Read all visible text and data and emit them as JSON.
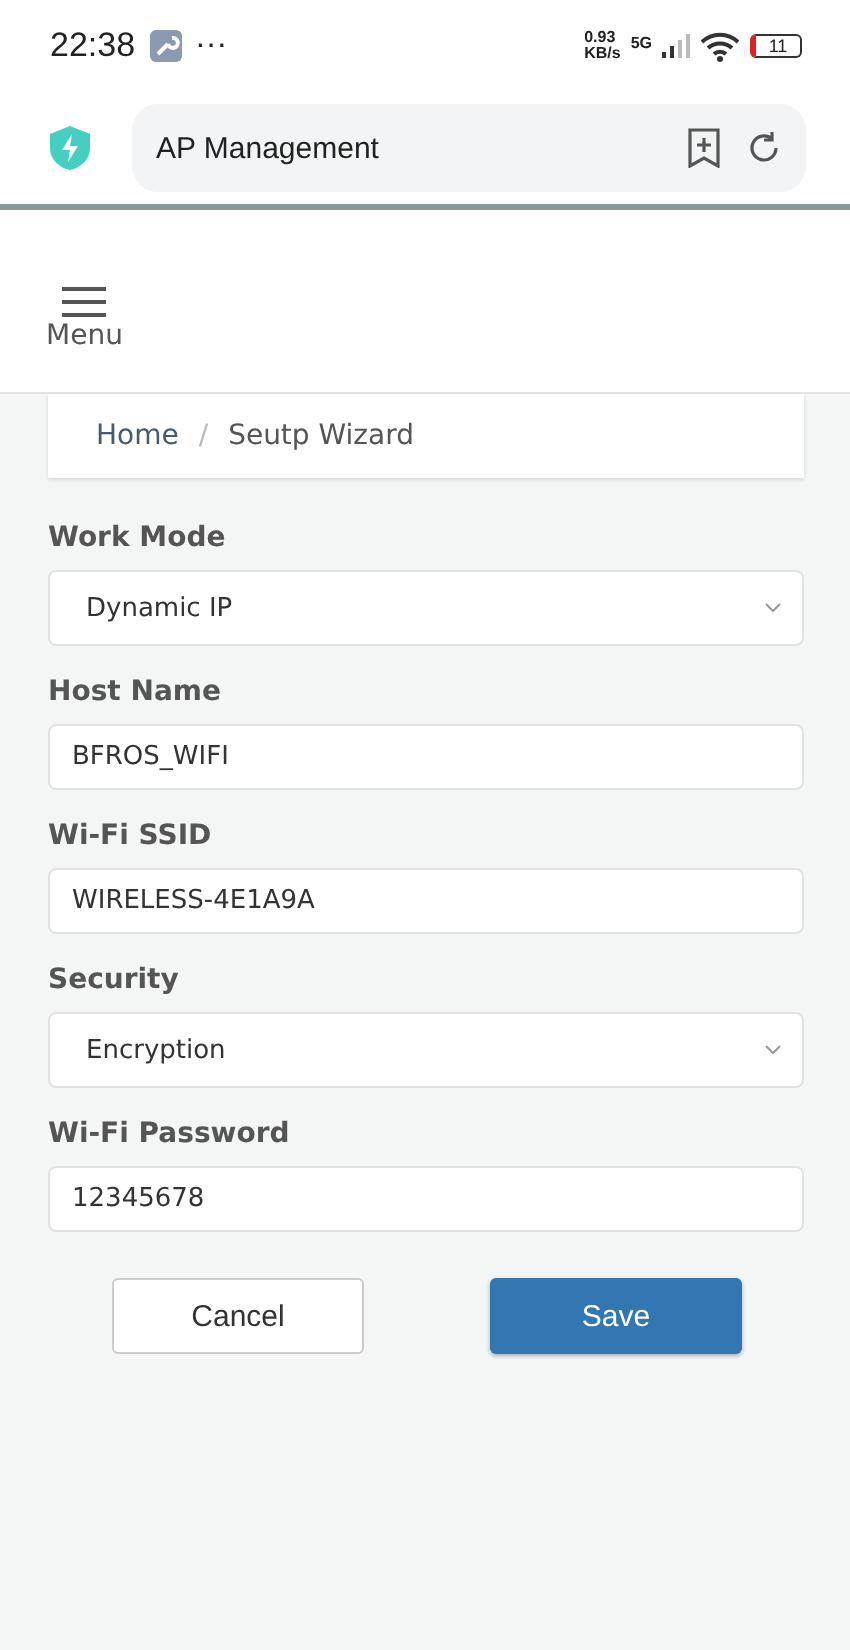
{
  "status_bar": {
    "time": "22:38",
    "more": "···",
    "speed_value": "0.93",
    "speed_unit": "KB/s",
    "network": "5G",
    "battery": "11"
  },
  "browser_bar": {
    "title": "AP Management"
  },
  "header": {
    "menu_label": "Menu"
  },
  "breadcrumb_separator": "/",
  "breadcrumb": [
    {
      "label": "Home",
      "selected": false
    },
    {
      "label": "Seutp Wizard",
      "selected": true
    }
  ],
  "form": [
    {
      "kind": "select",
      "label": "Work Mode",
      "value": "Dynamic IP"
    },
    {
      "kind": "text",
      "label": "Host Name",
      "value": "BFROS_WIFI"
    },
    {
      "kind": "text",
      "label": "Wi-Fi SSID",
      "value": "WIRELESS-4E1A9A"
    },
    {
      "kind": "select",
      "label": "Security",
      "value": "Encryption"
    },
    {
      "kind": "text",
      "label": "Wi-Fi Password",
      "value": "12345678"
    }
  ],
  "buttons": [
    {
      "kind": "secondary",
      "label": "Cancel"
    },
    {
      "kind": "primary",
      "label": "Save"
    }
  ]
}
